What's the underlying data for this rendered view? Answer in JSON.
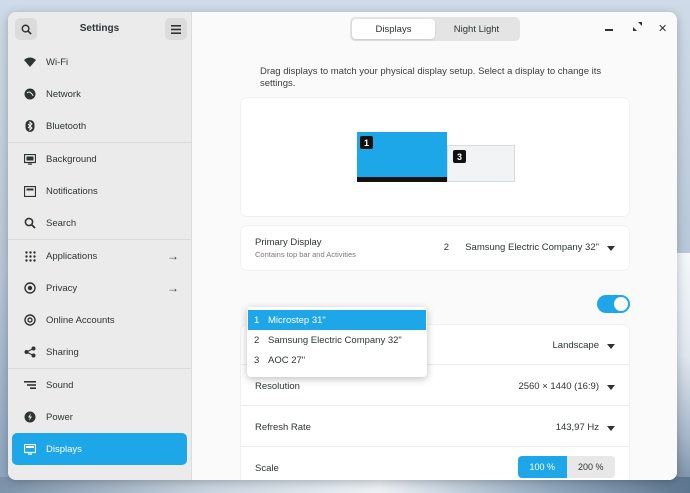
{
  "sidebar": {
    "title": "Settings",
    "items": [
      {
        "label": "Wi-Fi",
        "icon": "wifi-icon"
      },
      {
        "label": "Network",
        "icon": "network-icon"
      },
      {
        "label": "Bluetooth",
        "icon": "bluetooth-icon"
      },
      {
        "label": "Background",
        "icon": "background-icon"
      },
      {
        "label": "Notifications",
        "icon": "notifications-icon"
      },
      {
        "label": "Search",
        "icon": "search-icon"
      },
      {
        "label": "Applications",
        "icon": "applications-icon"
      },
      {
        "label": "Privacy",
        "icon": "privacy-icon"
      },
      {
        "label": "Online Accounts",
        "icon": "online-accounts-icon"
      },
      {
        "label": "Sharing",
        "icon": "sharing-icon"
      },
      {
        "label": "Sound",
        "icon": "sound-icon"
      },
      {
        "label": "Power",
        "icon": "power-icon"
      },
      {
        "label": "Displays",
        "icon": "displays-icon"
      }
    ]
  },
  "tabs": {
    "displays": "Displays",
    "night_light": "Night Light"
  },
  "hint": "Drag displays to match your physical display setup. Select a display to change its settings.",
  "arrangement": {
    "monitor1_badge": "1",
    "monitor3_badge": "3"
  },
  "primary": {
    "label": "Primary Display",
    "sublabel": "Contains top bar and Activities",
    "num": "2",
    "value": "Samsung Electric Company 32\""
  },
  "popover": {
    "items": [
      {
        "num": "1",
        "label": "Microstep 31\""
      },
      {
        "num": "2",
        "label": "Samsung Electric Company 32\""
      },
      {
        "num": "3",
        "label": "AOC 27\""
      }
    ]
  },
  "settings": {
    "orientation_value": "Landscape",
    "resolution_label": "Resolution",
    "resolution_value": "2560 × 1440 (16:9)",
    "refresh_label": "Refresh Rate",
    "refresh_value": "143,97 Hz",
    "scale_label": "Scale",
    "scale_100": "100 %",
    "scale_200": "200 %"
  },
  "colors": {
    "accent": "#1ea7e8"
  }
}
